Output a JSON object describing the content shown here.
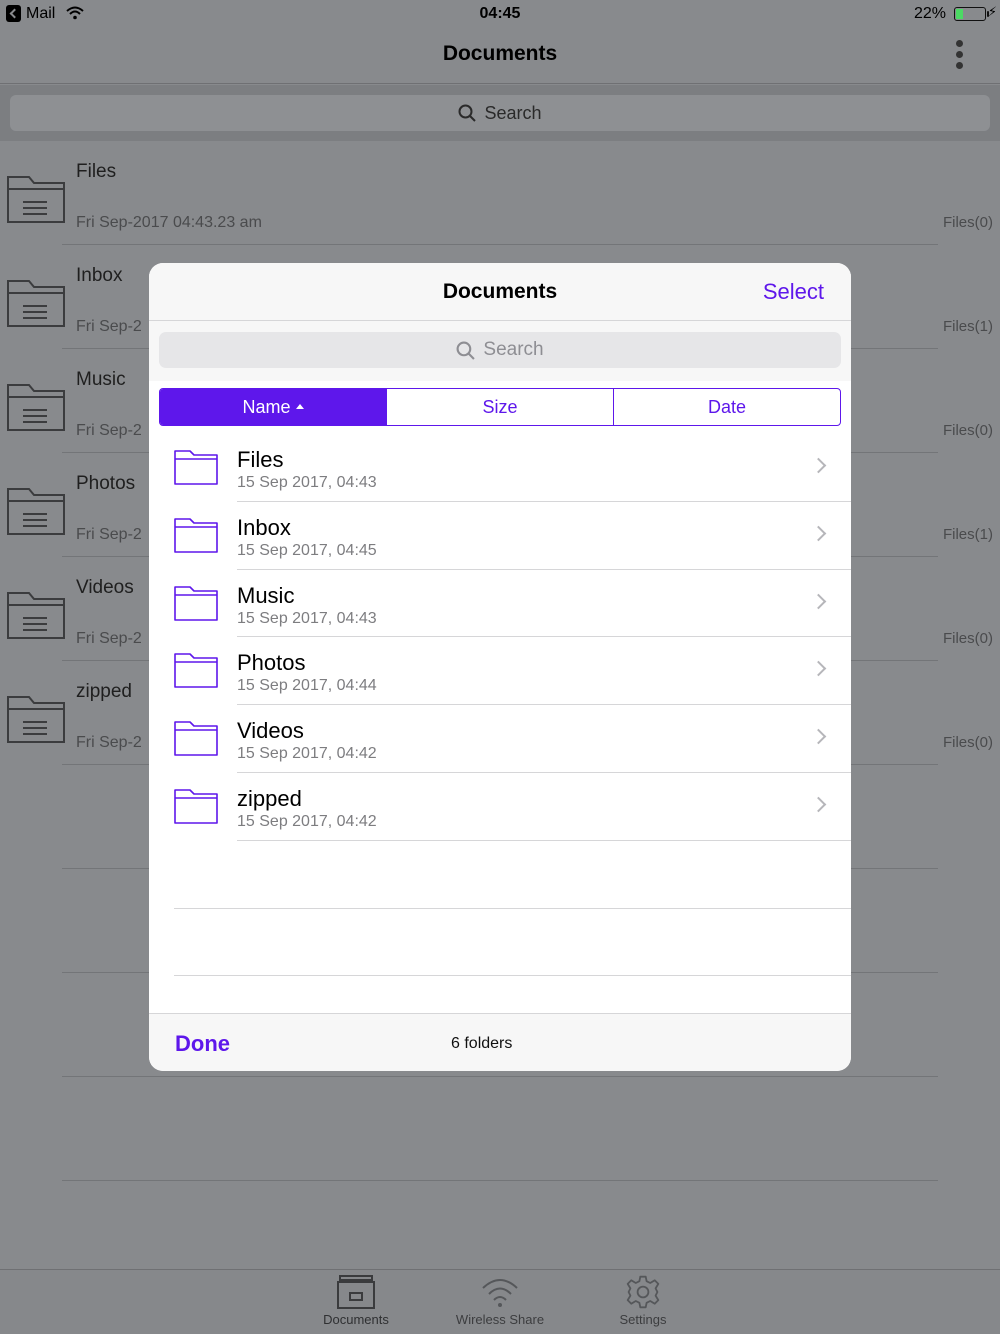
{
  "status_bar": {
    "back_app": "Mail",
    "time": "04:45",
    "battery_percent_label": "22%",
    "battery_level": 0.22
  },
  "nav": {
    "title": "Documents"
  },
  "background_search": {
    "placeholder": "Search"
  },
  "background_list": [
    {
      "name": "Files",
      "date": "Fri Sep-2017 04:43.23 am",
      "count": "Files(0)"
    },
    {
      "name": "Inbox",
      "date": "Fri Sep-2",
      "count": "Files(1)"
    },
    {
      "name": "Music",
      "date": "Fri Sep-2",
      "count": "Files(0)"
    },
    {
      "name": "Photos",
      "date": "Fri Sep-2",
      "count": "Files(1)"
    },
    {
      "name": "Videos",
      "date": "Fri Sep-2",
      "count": "Files(0)"
    },
    {
      "name": "zipped",
      "date": "Fri Sep-2",
      "count": "Files(0)"
    }
  ],
  "modal": {
    "title": "Documents",
    "select_label": "Select",
    "search_placeholder": "Search",
    "sort_tabs": [
      {
        "label": "Name",
        "active": true
      },
      {
        "label": "Size",
        "active": false
      },
      {
        "label": "Date",
        "active": false
      }
    ],
    "folders": [
      {
        "name": "Files",
        "date": "15 Sep 2017, 04:43"
      },
      {
        "name": "Inbox",
        "date": "15 Sep 2017, 04:45"
      },
      {
        "name": "Music",
        "date": "15 Sep 2017, 04:43"
      },
      {
        "name": "Photos",
        "date": "15 Sep 2017, 04:44"
      },
      {
        "name": "Videos",
        "date": "15 Sep 2017, 04:42"
      },
      {
        "name": "zipped",
        "date": "15 Sep 2017, 04:42"
      }
    ],
    "done_label": "Done",
    "summary": "6 folders"
  },
  "tabbar": {
    "items": [
      {
        "label": "Documents",
        "icon": "documents-box-icon"
      },
      {
        "label": "Wireless Share",
        "icon": "wifi-icon"
      },
      {
        "label": "Settings",
        "icon": "gear-icon"
      }
    ]
  },
  "colors": {
    "accent": "#5e17eb",
    "dim_background": "#888a8d",
    "battery_fill": "#4cd964"
  }
}
